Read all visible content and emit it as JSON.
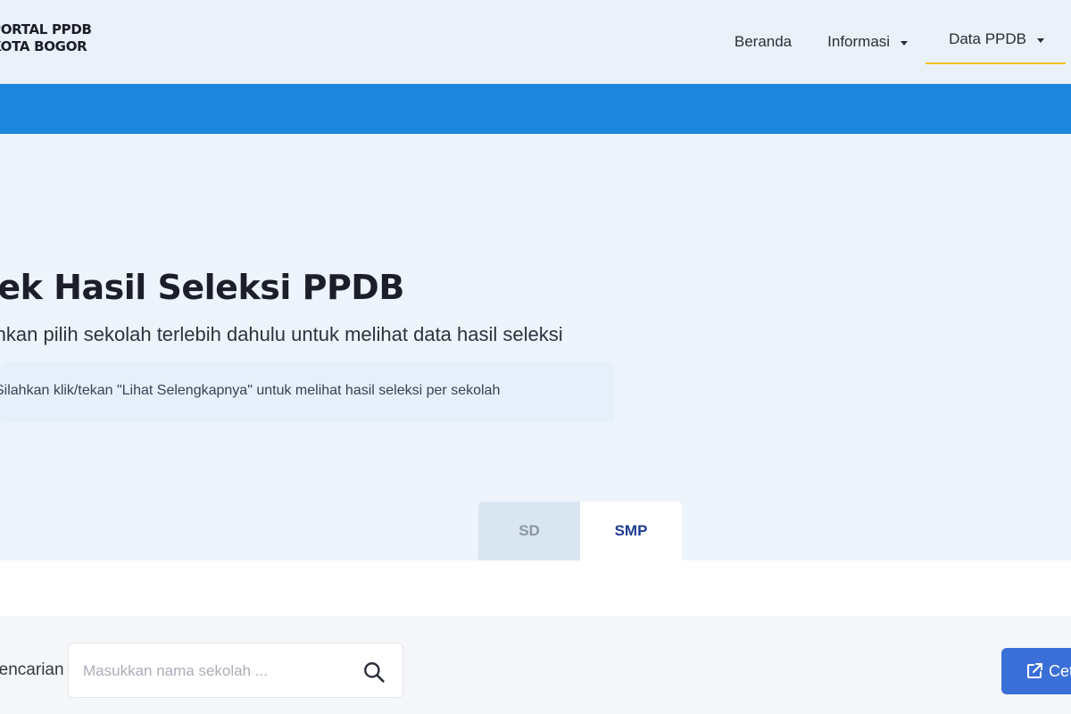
{
  "header": {
    "logo_line1": "PORTAL PPDB",
    "logo_line2": "KOTA BOGOR",
    "nav": {
      "beranda": "Beranda",
      "informasi": "Informasi",
      "data_ppdb": "Data PPDB"
    }
  },
  "hero": {
    "title": "Cek Hasil Seleksi PPDB",
    "subtitle": "Silahkan pilih sekolah terlebih dahulu untuk melihat data hasil seleksi",
    "notice": "Silahkan klik/tekan \"Lihat Selengkapnya\" untuk melihat hasil seleksi per sekolah"
  },
  "tabs": {
    "sd": "SD",
    "smp": "SMP",
    "active": "SMP"
  },
  "search": {
    "label": "Pencarian :",
    "placeholder": "Masukkan nama sekolah ..."
  },
  "actions": {
    "print_label": "Cetak"
  },
  "colors": {
    "blue_bar": "#1c87dc",
    "active_underline": "#f1c21b",
    "active_tab_text": "#1e3c8f",
    "print_button": "#3a6fd8"
  },
  "icons": {
    "search": "search-icon",
    "print": "external-link-icon",
    "dropdown": "caret-down-icon"
  }
}
